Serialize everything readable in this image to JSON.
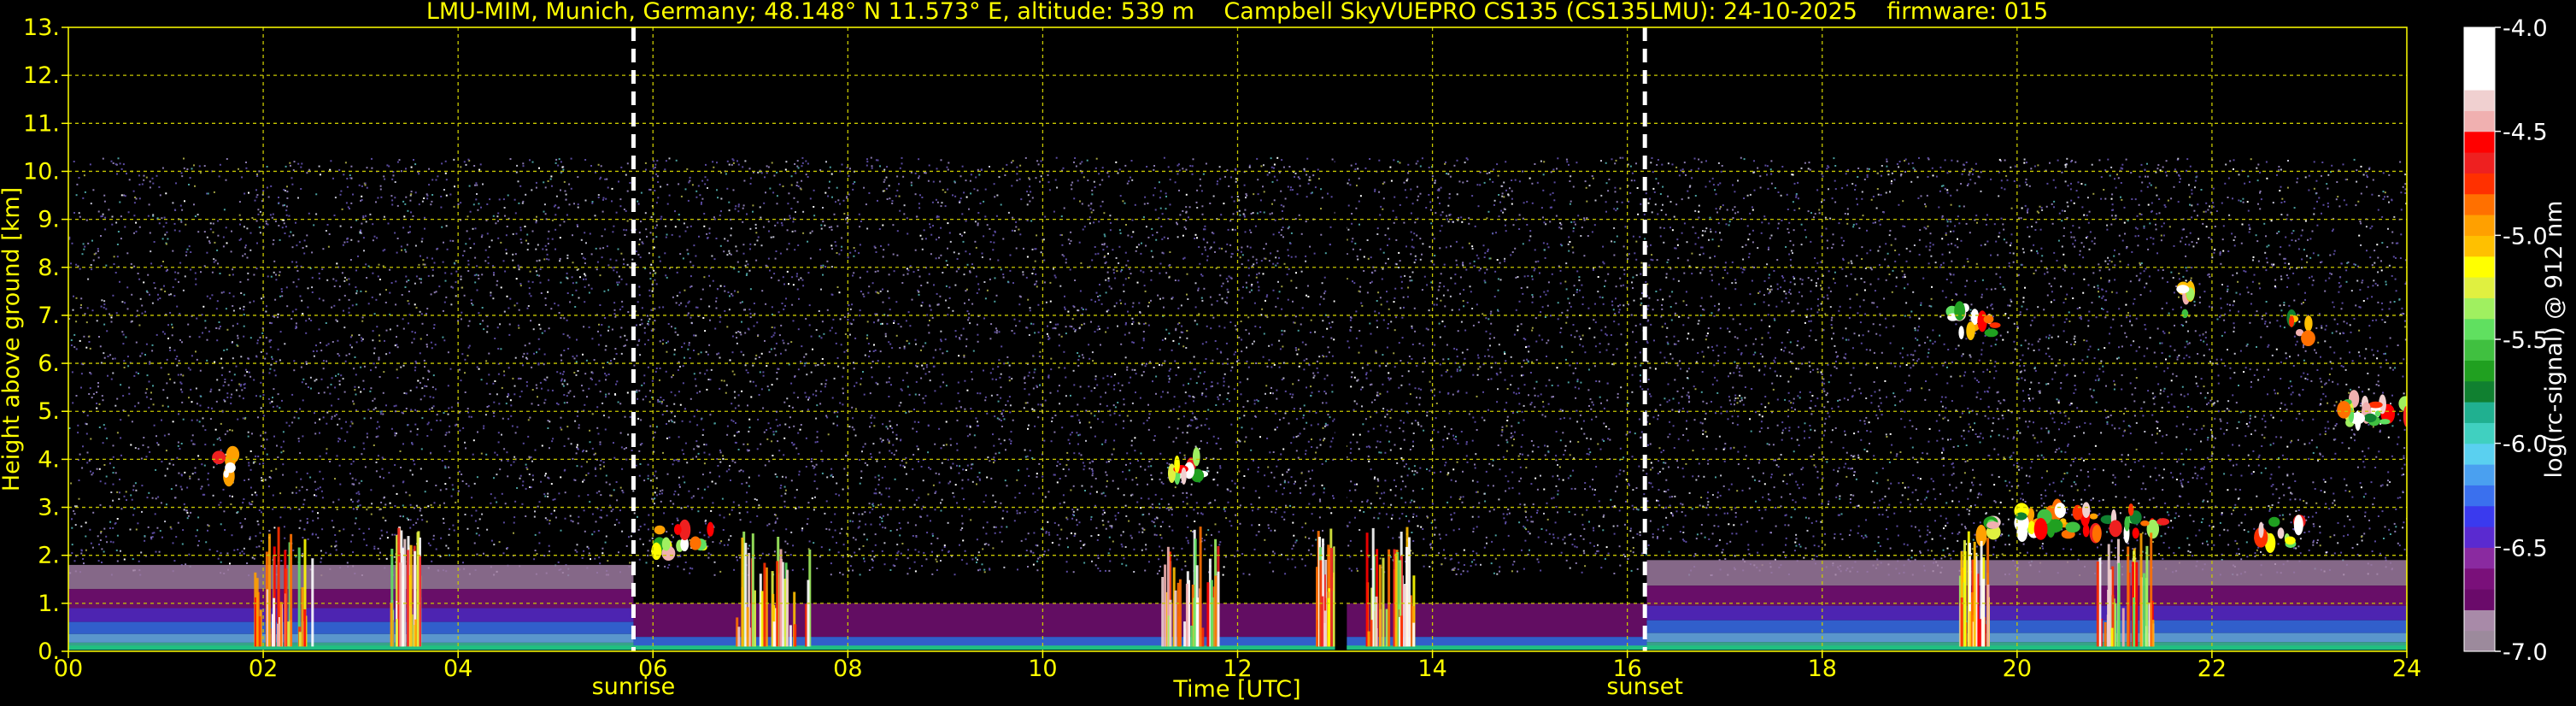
{
  "chart_data": {
    "type": "heatmap",
    "title": "LMU-MIM, Munich, Germany; 48.148° N 11.573° E, altitude: 539 m    Campbell SkyVUEPRO CS135 (CS135LMU): 24-10-2025    firmware: 015",
    "xlabel": "Time [UTC]",
    "ylabel": "Height above ground [km]",
    "xlim": [
      0,
      24
    ],
    "ylim": [
      0,
      13
    ],
    "x_ticks": [
      0,
      2,
      4,
      6,
      8,
      10,
      12,
      14,
      16,
      18,
      20,
      22,
      24
    ],
    "x_tick_labels": [
      "00",
      "02",
      "04",
      "06",
      "08",
      "10",
      "12",
      "14",
      "16",
      "18",
      "20",
      "22",
      "24"
    ],
    "y_ticks": [
      0,
      1,
      2,
      3,
      4,
      5,
      6,
      7,
      8,
      9,
      10,
      11,
      12,
      13
    ],
    "y_tick_labels": [
      "0.",
      "1.",
      "2.",
      "3.",
      "4.",
      "5.",
      "6.",
      "7.",
      "8.",
      "9.",
      "10.",
      "11.",
      "12.",
      "13."
    ],
    "grid": true,
    "signal_top_km": 10.3,
    "data_gap": [
      13.0,
      13.12
    ],
    "markers": [
      {
        "label": "sunrise",
        "x": 5.8
      },
      {
        "label": "sunset",
        "x": 16.18
      }
    ],
    "colorbar": {
      "label": "log(rc-signal) @ 912 nm",
      "range": [
        -7.0,
        -4.0
      ],
      "ticks": [
        -7.0,
        -6.5,
        -6.0,
        -5.5,
        -5.0,
        -4.5,
        -4.0
      ],
      "tick_labels": [
        "-7.0",
        "-6.5",
        "-6.0",
        "-5.5",
        "-5.0",
        "-4.5",
        "-4.0"
      ],
      "colors": [
        "#9c8a9c",
        "#a88aa8",
        "#6a0a6a",
        "#7a107a",
        "#8a2aa0",
        "#5a2ad0",
        "#3a3aee",
        "#3a70ee",
        "#4aa0f0",
        "#5ad0f0",
        "#40d0c0",
        "#20b090",
        "#108030",
        "#20a020",
        "#40c040",
        "#60e060",
        "#a0f060",
        "#e0f040",
        "#ffff00",
        "#ffc000",
        "#ffa000",
        "#ff7000",
        "#ff3000",
        "#ee2020",
        "#ff0000",
        "#f0b0b0",
        "#f0d0d0",
        "#ffffff",
        "#ffffff",
        "#ffffff"
      ]
    },
    "features": [
      {
        "kind": "aerosol_layer",
        "t0": 0,
        "t1": 5.8,
        "z_top_km": 1.8
      },
      {
        "kind": "aerosol_layer",
        "t0": 16.2,
        "t1": 24,
        "z_top_km": 1.9
      },
      {
        "kind": "cloud",
        "t0": 1.5,
        "t1": 1.7,
        "z_km": 3.9
      },
      {
        "kind": "cloud",
        "t0": 11.3,
        "t1": 11.7,
        "z_km": 3.9
      },
      {
        "kind": "cloud",
        "t0": 19.3,
        "t1": 19.8,
        "z_km": 6.9
      },
      {
        "kind": "cloud",
        "t0": 21.7,
        "t1": 21.8,
        "z_km": 7.3
      },
      {
        "kind": "cloud",
        "t0": 22.8,
        "t1": 23.0,
        "z_km": 6.7
      },
      {
        "kind": "cloud",
        "t0": 23.3,
        "t1": 24,
        "z_km": 5.0
      },
      {
        "kind": "cloud",
        "t0": 20.0,
        "t1": 21.5,
        "z_km": 2.7
      },
      {
        "kind": "cloud",
        "t0": 22.5,
        "t1": 22.9,
        "z_km": 2.5
      },
      {
        "kind": "cloud",
        "t0": 6.0,
        "t1": 6.6,
        "z_km": 2.3
      },
      {
        "kind": "cloud",
        "t0": 19.6,
        "t1": 19.8,
        "z_km": 2.6
      }
    ]
  }
}
